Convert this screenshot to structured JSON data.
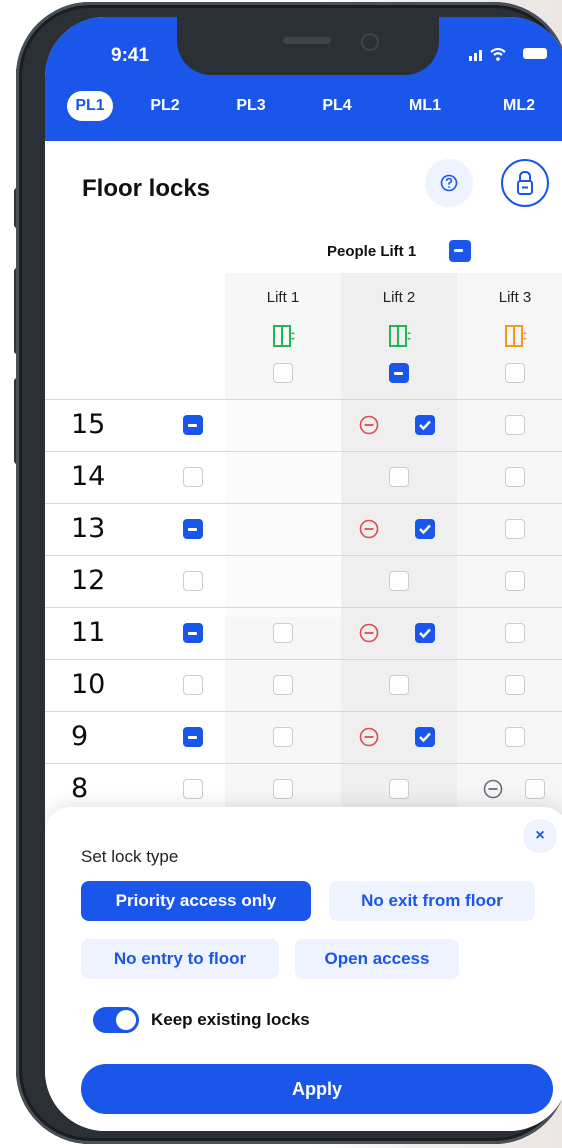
{
  "status_bar": {
    "time": "9:41",
    "signal_icon": "signal-wifi-icon",
    "battery_icon": "battery-icon"
  },
  "tabs": [
    {
      "label": "PL1",
      "active": true
    },
    {
      "label": "PL2",
      "active": false
    },
    {
      "label": "PL3",
      "active": false
    },
    {
      "label": "PL4",
      "active": false
    },
    {
      "label": "ML1",
      "active": false
    },
    {
      "label": "ML2",
      "active": false
    }
  ],
  "header": {
    "title": "Floor locks",
    "help_icon": "question-icon",
    "lock_icon": "lock-icon"
  },
  "lift_group": {
    "label": "People Lift 1",
    "state": "mixed"
  },
  "lifts": [
    {
      "label": "Lift 1",
      "door_color": "#22b455",
      "state": "unchecked"
    },
    {
      "label": "Lift 2",
      "door_color": "#22b455",
      "state": "mixed"
    },
    {
      "label": "Lift 3",
      "door_color": "#f29a1f",
      "state": "unchecked"
    }
  ],
  "floors": [
    {
      "number": "15",
      "row_state": "mixed",
      "cells": [
        "none",
        "lock_checked",
        "unchecked"
      ]
    },
    {
      "number": "14",
      "row_state": "unchecked",
      "cells": [
        "none",
        "unchecked",
        "unchecked"
      ]
    },
    {
      "number": "13",
      "row_state": "mixed",
      "cells": [
        "none",
        "lock_checked",
        "unchecked"
      ]
    },
    {
      "number": "12",
      "row_state": "unchecked",
      "cells": [
        "none",
        "unchecked",
        "unchecked"
      ]
    },
    {
      "number": "11",
      "row_state": "mixed",
      "cells": [
        "unchecked",
        "lock_checked",
        "unchecked"
      ]
    },
    {
      "number": "10",
      "row_state": "unchecked",
      "cells": [
        "unchecked",
        "unchecked",
        "unchecked"
      ]
    },
    {
      "number": "9",
      "row_state": "mixed",
      "cells": [
        "unchecked",
        "lock_checked",
        "unchecked"
      ]
    },
    {
      "number": "8",
      "row_state": "unchecked",
      "cells": [
        "unchecked",
        "unchecked",
        "lock_gray_unchecked"
      ]
    }
  ],
  "lock_panel": {
    "title": "Set lock type",
    "close_label": "×",
    "options": [
      {
        "label": "Priority access only",
        "active": true
      },
      {
        "label": "No exit from floor",
        "active": false
      },
      {
        "label": "No entry to floor",
        "active": false
      },
      {
        "label": "Open access",
        "active": false
      }
    ],
    "keep_existing": {
      "label": "Keep existing locks",
      "on": true
    },
    "apply_label": "Apply"
  },
  "colors": {
    "accent": "#1a56ea",
    "lock_red": "#e5484d",
    "lock_gray": "#6b6f76"
  }
}
